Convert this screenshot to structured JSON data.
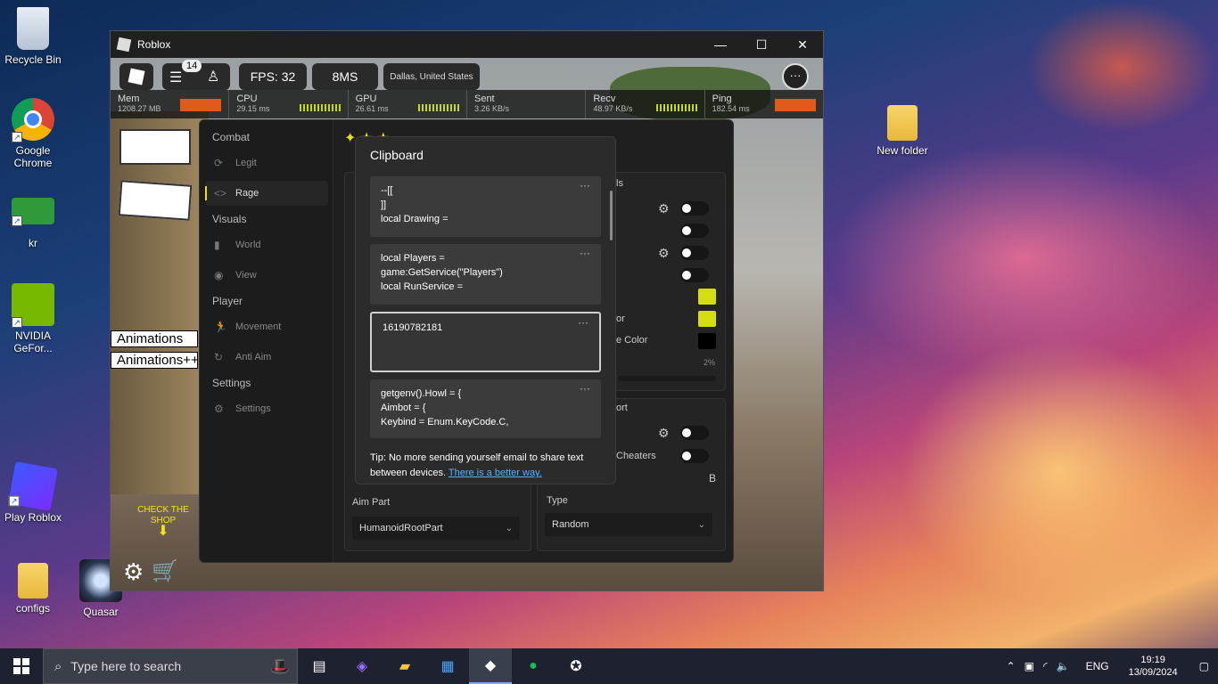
{
  "desktop": {
    "icons": [
      {
        "label": "Recycle Bin"
      },
      {
        "label": "Google Chrome"
      },
      {
        "label": "kr"
      },
      {
        "label": "NVIDIA GeFor..."
      },
      {
        "label": "Play Roblox"
      },
      {
        "label": "configs"
      },
      {
        "label": "Quasar"
      },
      {
        "label": "New folder"
      }
    ]
  },
  "roblox_window": {
    "title": "Roblox",
    "controls": {
      "minimize": "—",
      "maximize": "☐",
      "close": "✕"
    },
    "hud": {
      "notification_count": "14",
      "fps": "FPS: 32",
      "ms": "8MS",
      "location": "Dallas, United States",
      "more": "···"
    },
    "stats": [
      {
        "name": "Mem",
        "value": "1208.27 MB"
      },
      {
        "name": "CPU",
        "value": "29.15 ms"
      },
      {
        "name": "GPU",
        "value": "26.61 ms"
      },
      {
        "name": "Sent",
        "value": "3.26 KB/s"
      },
      {
        "name": "Recv",
        "value": "48.97 KB/s"
      },
      {
        "name": "Ping",
        "value": "182.54 ms"
      }
    ],
    "side_labels": {
      "animations": "Animations",
      "animations_pp": "Animations++"
    },
    "shop_hint": "CHECK THE SHOP"
  },
  "cheat_menu": {
    "sidebar": {
      "sections": [
        {
          "title": "Combat",
          "items": [
            "Legit",
            "Rage"
          ]
        },
        {
          "title": "Visuals",
          "items": [
            "World",
            "View"
          ]
        },
        {
          "title": "Player",
          "items": [
            "Movement",
            "Anti Aim"
          ]
        },
        {
          "title": "Settings",
          "items": [
            "Settings"
          ]
        }
      ],
      "active": "Rage"
    },
    "left_panel": {
      "aim_part_label": "Aim Part",
      "aim_part_value": "HumanoidRootPart"
    },
    "right_panel": {
      "header_visible": "ls",
      "partial_labels": [
        "or",
        "e Color"
      ],
      "percent": "2%",
      "second_header": "ort",
      "cheaters_label": "Cheaters",
      "key": "B",
      "type_label": "Type",
      "type_value": "Random"
    },
    "colors": {
      "accent": "#d4dd12",
      "black_swatch": "#000000"
    }
  },
  "clipboard": {
    "title": "Clipboard",
    "items": [
      {
        "lines": [
          "--[[",
          "]]",
          "local Drawing ="
        ]
      },
      {
        "lines": [
          "local Players =",
          "game:GetService(\"Players\")",
          "local RunService ="
        ]
      },
      {
        "lines": [
          "16190782181"
        ]
      },
      {
        "lines": [
          "getgenv().Howl = {",
          "Aimbot = {",
          "Keybind = Enum.KeyCode.C,"
        ]
      }
    ],
    "more_label": "···",
    "tip_text": "Tip: No more sending yourself email to share text between devices. ",
    "tip_link": "There is a better way."
  },
  "taskbar": {
    "search_placeholder": "Type here to search",
    "language": "ENG",
    "time": "19:19",
    "date": "13/09/2024"
  }
}
